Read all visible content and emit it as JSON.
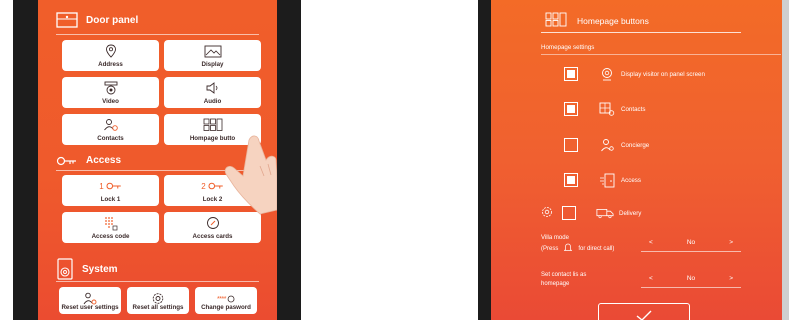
{
  "left_panel": {
    "door_panel": {
      "title": "Door panel",
      "tiles": [
        {
          "label": "Address",
          "icon": "location-pin-icon"
        },
        {
          "label": "Display",
          "icon": "display-image-icon"
        },
        {
          "label": "Video",
          "icon": "camera-icon"
        },
        {
          "label": "Audio",
          "icon": "speaker-icon"
        },
        {
          "label": "Contacts",
          "icon": "contacts-icon"
        },
        {
          "label": "Hompage butto",
          "icon": "grid-buttons-icon"
        }
      ]
    },
    "access": {
      "title": "Access",
      "tiles": [
        {
          "label": "Lock 1",
          "top": "1",
          "icon": "key-icon"
        },
        {
          "label": "Lock 2",
          "top": "2",
          "icon": "key-icon"
        },
        {
          "label": "Access code",
          "icon": "keypad-icon"
        },
        {
          "label": "Access cards",
          "icon": "card-icon"
        }
      ]
    },
    "system": {
      "title": "System",
      "tiles": [
        {
          "label": "Reset user settings",
          "icon": "user-gear-icon"
        },
        {
          "label": "Reset all settings",
          "icon": "gear-icon"
        },
        {
          "label": "Change pasword",
          "top": "****",
          "icon": "password-icon"
        }
      ]
    }
  },
  "right_panel": {
    "title": "Homepage buttons",
    "subtitle": "Homepage settings",
    "options": [
      {
        "label": "Display visitor on panel screen",
        "checked": true,
        "icon": "webcam-icon"
      },
      {
        "label": "Contacts",
        "checked": true,
        "icon": "contacts-grid-icon"
      },
      {
        "label": "Concierge",
        "checked": false,
        "icon": "concierge-icon"
      },
      {
        "label": "Access",
        "checked": true,
        "icon": "door-access-icon"
      },
      {
        "label": "Delivery",
        "checked": false,
        "icon": "delivery-truck-icon"
      }
    ],
    "villa_mode": {
      "line1": "Villa mode",
      "line2_a": "(Press",
      "line2_b": "for direct call)",
      "value": "No"
    },
    "contact_homepage": {
      "line1": "Set contact lis as",
      "line2": "homepage",
      "value": "No"
    },
    "prev_arrow": "<",
    "next_arrow": ">"
  },
  "colors": {
    "accent": "#f05e2a",
    "screen_bottom": "#eb4c30",
    "bezel": "#1c1c1c"
  }
}
